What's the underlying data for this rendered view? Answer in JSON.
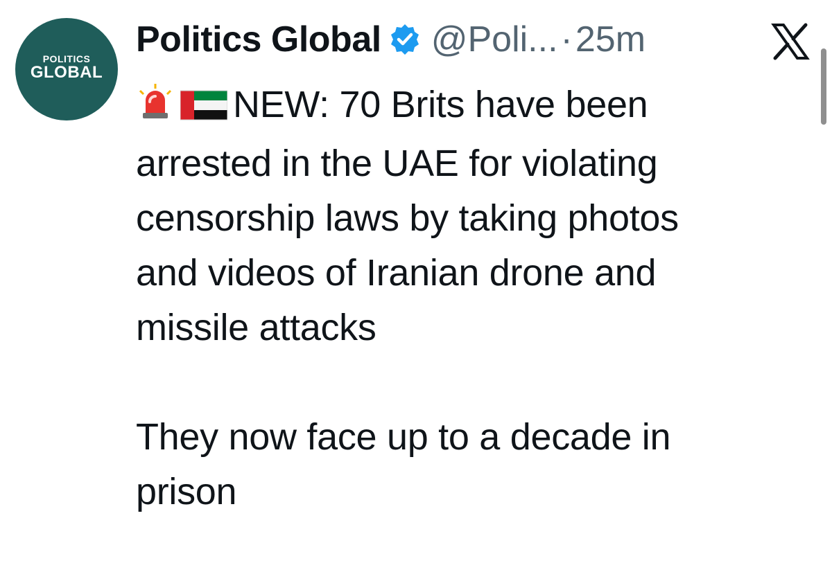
{
  "avatar": {
    "line1": "POLITICS",
    "line2": "GLOBAL",
    "color": "#1f5d5a"
  },
  "header": {
    "display_name": "Politics Global",
    "handle": "@Poli...",
    "separator": "·",
    "time": "25m",
    "verified_icon": "verified-badge-icon",
    "platform_icon": "x-logo-icon"
  },
  "tweet": {
    "emojis": [
      "rotating-light-icon",
      "uae-flag-icon"
    ],
    "first_line": "NEW: 70 Brits have been",
    "line2": "arrested in the UAE for violating",
    "line3": "censorship laws by taking photos",
    "line4": "and videos of Iranian drone and",
    "line5": "missile attacks",
    "paragraph2_line1": "They now face up to a decade in",
    "paragraph2_line2": "prison"
  },
  "colors": {
    "text": "#0f1419",
    "secondary": "#536471",
    "verified": "#1d9bf0"
  }
}
